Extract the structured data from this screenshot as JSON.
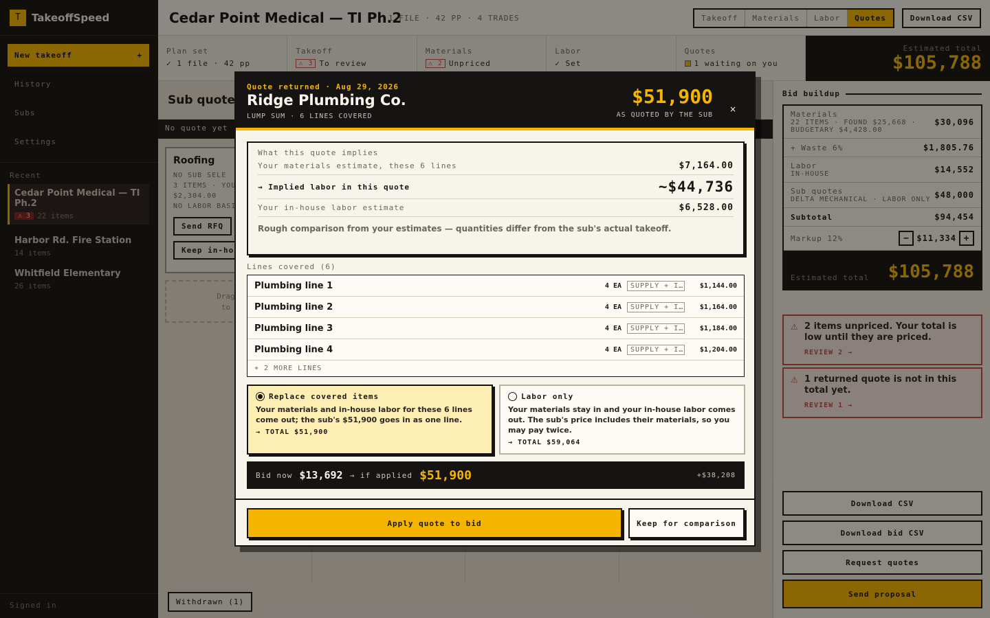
{
  "app": {
    "logo_letter": "T",
    "name": "TakeoffSpeed"
  },
  "sidebar": {
    "new_takeoff": "New takeoff",
    "new_plus": "+",
    "nav": [
      "History",
      "Subs",
      "Settings"
    ],
    "recent_heading": "Recent",
    "recent": [
      {
        "name": "Cedar Point Medical — TI Ph.2",
        "badge": "⚠ 3",
        "meta": "22 items"
      },
      {
        "name": "Harbor Rd. Fire Station",
        "meta": "14 items"
      },
      {
        "name": "Whitfield Elementary",
        "meta": "26 items"
      }
    ],
    "signed_in": "Signed in"
  },
  "header": {
    "title": "Cedar Point Medical — TI Ph.2",
    "meta": "1 FILE · 42 PP · 4 TRADES",
    "tabs": [
      "Takeoff",
      "Materials",
      "Labor",
      "Quotes"
    ],
    "active_tab": "Quotes",
    "download_csv": "Download CSV"
  },
  "steps": [
    {
      "label": "Plan set",
      "value": "✓ 1 file · 42 pp"
    },
    {
      "label": "Takeoff",
      "badge": "⚠ 3",
      "value": "To review"
    },
    {
      "label": "Materials",
      "badge": "⚠ 2",
      "value": "Unpriced"
    },
    {
      "label": "Labor",
      "value": "✓ Set"
    },
    {
      "label": "Quotes",
      "value": "1 waiting on you"
    }
  ],
  "estimate": {
    "label": "Estimated total",
    "value": "$105,788"
  },
  "main": {
    "heading": "Sub quotes",
    "noquote": "No quote yet",
    "card": {
      "title": "Roofing",
      "meta1": "NO SUB SELE",
      "meta2": "3 ITEMS · YOU",
      "meta3": "$2,304.00",
      "meta4": "NO LABOR BASI",
      "send_rfq": "Send RFQ",
      "keep_inhouse": "Keep in-hou"
    },
    "drop1": "Drag a se",
    "drop2": "to un-s",
    "withdrawn": "Withdrawn (1)"
  },
  "buildup": {
    "heading": "Bid buildup",
    "rows": [
      {
        "label": "Materials",
        "sub": "22 ITEMS · FOUND $25,668 · BUDGETARY $4,428.00",
        "value": "$30,096"
      },
      {
        "label": "+ Waste 6%",
        "value": "$1,805.76"
      },
      {
        "label": "Labor",
        "sub": "IN-HOUSE",
        "value": "$14,552"
      },
      {
        "label": "Sub quotes",
        "sub": "DELTA MECHANICAL · LABOR ONLY",
        "value": "$48,000"
      },
      {
        "label": "Subtotal",
        "value": "$94,454"
      },
      {
        "label": "Markup 12%",
        "value": "$11,334"
      }
    ],
    "minus": "−",
    "plus": "+",
    "total_label": "Estimated total",
    "total_value": "$105,788"
  },
  "alerts": [
    {
      "icon": "⚠",
      "text": "2 items unpriced. Your total is low until they are priced.",
      "link": "REVIEW 2 →"
    },
    {
      "icon": "⚠",
      "text": "1 returned quote is not in this total yet.",
      "link": "REVIEW 1 →"
    }
  ],
  "right_buttons": {
    "download_csv": "Download CSV",
    "download_bid_csv": "Download bid CSV",
    "request_quotes": "Request quotes",
    "send_proposal": "Send proposal"
  },
  "modal": {
    "kicker": "Quote returned · Aug 29, 2026",
    "sub_name": "Ridge Plumbing Co.",
    "lump": "LUMP SUM · 6 LINES COVERED",
    "amount": "$51,900",
    "amount_label": "AS QUOTED BY THE SUB",
    "close": "×",
    "implies": {
      "heading": "What this quote implies",
      "materials_label": "Your materials estimate, these 6 lines",
      "materials_value": "$7,164.00",
      "implied_label": "→ Implied labor in this quote",
      "implied_value": "~$44,736",
      "inhouse_label": "Your in-house labor estimate",
      "inhouse_value": "$6,528.00",
      "note": "Rough comparison from your estimates — quantities differ from the sub's actual takeoff."
    },
    "lines_heading": "Lines covered (6)",
    "lines": [
      {
        "name": "Plumbing line 1",
        "qty": "4 EA",
        "tag": "SUPPLY + I…",
        "price": "$1,144.00"
      },
      {
        "name": "Plumbing line 2",
        "qty": "4 EA",
        "tag": "SUPPLY + I…",
        "price": "$1,164.00"
      },
      {
        "name": "Plumbing line 3",
        "qty": "4 EA",
        "tag": "SUPPLY + I…",
        "price": "$1,184.00"
      },
      {
        "name": "Plumbing line 4",
        "qty": "4 EA",
        "tag": "SUPPLY + I…",
        "price": "$1,204.00"
      }
    ],
    "more_lines": "+ 2 MORE LINES",
    "option_replace": {
      "title": "Replace covered items",
      "body": "Your materials and in-house labor for these 6 lines come out; the sub's $51,900 goes in as one line.",
      "total": "→ TOTAL $51,900"
    },
    "option_labor": {
      "title": "Labor only",
      "body": "Your materials stay in and your in-house labor comes out. The sub's price includes their materials, so you may pay twice.",
      "total": "→ TOTAL $59,064"
    },
    "bid_now_label": "Bid now",
    "bid_now_value": "$13,692",
    "if_applied_label": "→ if applied",
    "if_applied_value": "$51,900",
    "delta": "+$38,208",
    "apply": "Apply quote to bid",
    "keep": "Keep for comparison"
  }
}
